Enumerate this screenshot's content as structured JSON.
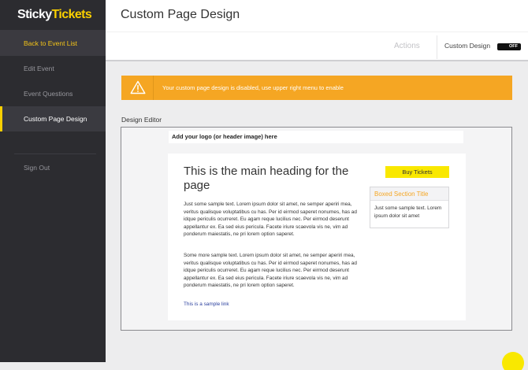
{
  "brand": {
    "part1": "Sticky",
    "part2": "Tickets"
  },
  "sidebar": {
    "items": [
      {
        "label": "Back to Event List"
      },
      {
        "label": "Edit Event"
      },
      {
        "label": "Event Questions"
      },
      {
        "label": "Custom Page Design"
      },
      {
        "label": "Sign Out"
      }
    ]
  },
  "header": {
    "title": "Custom Page Design"
  },
  "actionbar": {
    "actions_label": "Actions",
    "custom_design_label": "Custom Design",
    "toggle_state": "OFF"
  },
  "warning": {
    "text": "Your custom page design is disabled, use upper right menu to enable",
    "icon": "warning-icon"
  },
  "editor": {
    "label": "Design Editor",
    "logo_placeholder": "Add your logo (or header image) here",
    "main_heading": "This is the main heading for the page",
    "para1": "Just some sample text. Lorem ipsum dolor sit amet, ne semper aperiri mea, veritus qualisque voluptatibus cu has. Per id eirmod saperet nonumes, has ad idque periculis ocurreret. Eu agam reque lucilius nec. Per eirmod deserunt appellantur ex. Ea sed eius pericula. Facete iriure scaevola vis ne, vim ad ponderum maiestatis, ne pri lorem option saperet.",
    "para2": "Some more sample text. Lorem ipsum dolor sit amet, ne semper aperiri mea, veritus qualisque voluptatibus cu has. Per id eirmod saperet nonumes, has ad idque periculis ocurreret. Eu agam reque lucilius nec. Per eirmod deserunt appellantur ex. Ea sed eius pericula. Facete iriure scaevola vis ne, vim ad ponderum maiestatis, ne pri lorem option saperet.",
    "link": "This is a sample link",
    "buy_button": "Buy Tickets",
    "boxed_title": "Boxed Section Title",
    "boxed_body": "Just some sample text. Lorem ipsum dolor sit amet"
  },
  "colors": {
    "accent": "#f9cf00",
    "warning": "#f5a623",
    "sidebar": "#2c2c30"
  }
}
